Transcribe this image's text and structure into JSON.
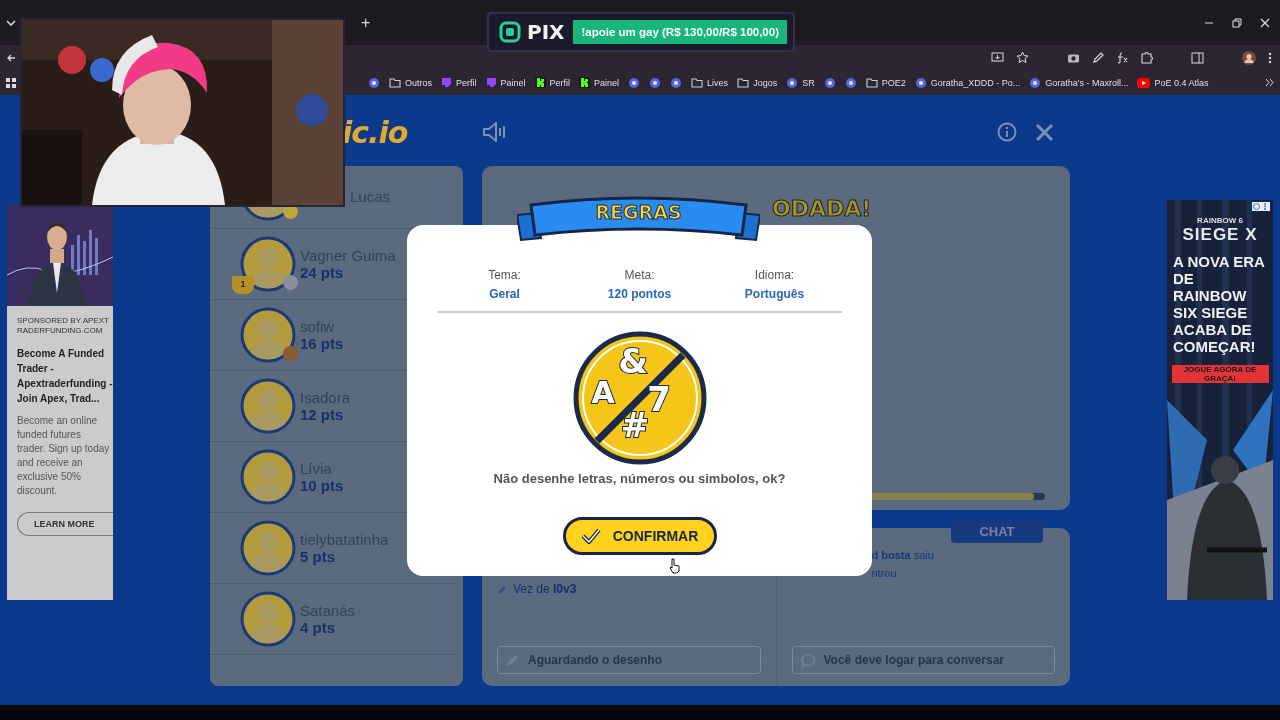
{
  "browser": {
    "new_tab": "+",
    "bookmarks": [
      {
        "kind": "site"
      },
      {
        "kind": "folder",
        "label": "Outros"
      },
      {
        "kind": "twitch",
        "label": "Perfil"
      },
      {
        "kind": "twitch",
        "label": "Painel"
      },
      {
        "kind": "kick",
        "label": "Perfil"
      },
      {
        "kind": "kick",
        "label": "Painel"
      },
      {
        "kind": "site"
      },
      {
        "kind": "site"
      },
      {
        "kind": "site"
      },
      {
        "kind": "folder",
        "label": "Lives"
      },
      {
        "kind": "folder",
        "label": "Jogos"
      },
      {
        "kind": "site",
        "label": "SR"
      },
      {
        "kind": "site"
      },
      {
        "kind": "site"
      },
      {
        "kind": "folder",
        "label": "POE2"
      },
      {
        "kind": "site",
        "label": "Goratha_XDDD - Po..."
      },
      {
        "kind": "site",
        "label": "Goratha's - Maxroll..."
      },
      {
        "kind": "youtube",
        "label": "PoE 0.4 Atlas"
      }
    ]
  },
  "alert": {
    "logo": "PIX",
    "message": "!apoie um gay (R$ 130,00/R$ 100,00)"
  },
  "left_ad": {
    "sponsor": "SPONSORED BY APEXTRADERFUNDING.COM",
    "headline": "Become A Funded Trader - Apextraderfunding - Join Apex, Trad...",
    "body": "Become an online funded futures trader. Sign up today and receive an exclusive 50% discount.",
    "button": "LEARN MORE"
  },
  "right_ad": {
    "brand_small": "RAINBOW 6",
    "brand": "SIEGE X",
    "headline": "A NOVA ERA DE RAINBOW SIX SIEGE ACABA DE COMEÇAR!",
    "button": "JOGUE AGORA DE GRAÇA!"
  },
  "game": {
    "logo": "ic.io",
    "players": [
      {
        "name": "Lucas",
        "color": "#b9a73a"
      },
      {
        "name": "Vagner Guima",
        "points": "24 pts",
        "color": "#8a909a",
        "trophy": "1"
      },
      {
        "name": "sofiw",
        "points": "16 pts",
        "color": "#8a5a34"
      },
      {
        "name": "Isadora",
        "points": "12 pts"
      },
      {
        "name": "Lívia",
        "points": "10 pts"
      },
      {
        "name": "tielybatatinha",
        "points": "5 pts"
      },
      {
        "name": "Satanás",
        "points": "4 pts"
      }
    ],
    "round_title": "ODADA!",
    "timer": {
      "level": 0.98
    },
    "turn_label": "Vez de",
    "turn_player": "l0v3",
    "draw_placeholder": "Aguardando o desenho",
    "chat_tab": "CHAT",
    "chat_messages": [
      {
        "user": "d bosta",
        "text": "saiu"
      },
      {
        "text": "ntrou"
      }
    ],
    "chat_placeholder": "Você deve logar para conversar"
  },
  "modal": {
    "banner": "REGRAS",
    "stats": [
      {
        "label": "Tema:",
        "value": "Geral"
      },
      {
        "label": "Meta:",
        "value": "120 pontos"
      },
      {
        "label": "Idioma:",
        "value": "Português"
      }
    ],
    "symbols": [
      "&",
      "A",
      "7",
      "#"
    ],
    "message": "Não desenhe letras, números ou simbolos, ok?",
    "button": "CONFIRMAR"
  }
}
